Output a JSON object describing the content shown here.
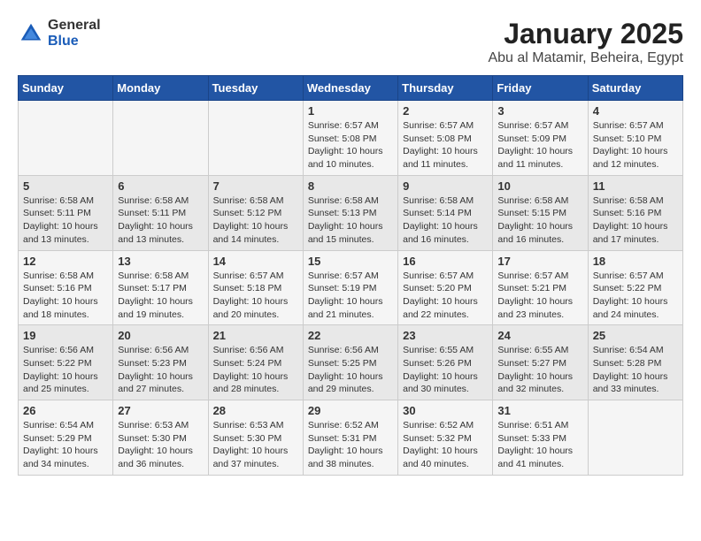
{
  "logo": {
    "general": "General",
    "blue": "Blue"
  },
  "title": "January 2025",
  "subtitle": "Abu al Matamir, Beheira, Egypt",
  "days_header": [
    "Sunday",
    "Monday",
    "Tuesday",
    "Wednesday",
    "Thursday",
    "Friday",
    "Saturday"
  ],
  "weeks": [
    [
      {
        "day": "",
        "info": ""
      },
      {
        "day": "",
        "info": ""
      },
      {
        "day": "",
        "info": ""
      },
      {
        "day": "1",
        "info": "Sunrise: 6:57 AM\nSunset: 5:08 PM\nDaylight: 10 hours\nand 10 minutes."
      },
      {
        "day": "2",
        "info": "Sunrise: 6:57 AM\nSunset: 5:08 PM\nDaylight: 10 hours\nand 11 minutes."
      },
      {
        "day": "3",
        "info": "Sunrise: 6:57 AM\nSunset: 5:09 PM\nDaylight: 10 hours\nand 11 minutes."
      },
      {
        "day": "4",
        "info": "Sunrise: 6:57 AM\nSunset: 5:10 PM\nDaylight: 10 hours\nand 12 minutes."
      }
    ],
    [
      {
        "day": "5",
        "info": "Sunrise: 6:58 AM\nSunset: 5:11 PM\nDaylight: 10 hours\nand 13 minutes."
      },
      {
        "day": "6",
        "info": "Sunrise: 6:58 AM\nSunset: 5:11 PM\nDaylight: 10 hours\nand 13 minutes."
      },
      {
        "day": "7",
        "info": "Sunrise: 6:58 AM\nSunset: 5:12 PM\nDaylight: 10 hours\nand 14 minutes."
      },
      {
        "day": "8",
        "info": "Sunrise: 6:58 AM\nSunset: 5:13 PM\nDaylight: 10 hours\nand 15 minutes."
      },
      {
        "day": "9",
        "info": "Sunrise: 6:58 AM\nSunset: 5:14 PM\nDaylight: 10 hours\nand 16 minutes."
      },
      {
        "day": "10",
        "info": "Sunrise: 6:58 AM\nSunset: 5:15 PM\nDaylight: 10 hours\nand 16 minutes."
      },
      {
        "day": "11",
        "info": "Sunrise: 6:58 AM\nSunset: 5:16 PM\nDaylight: 10 hours\nand 17 minutes."
      }
    ],
    [
      {
        "day": "12",
        "info": "Sunrise: 6:58 AM\nSunset: 5:16 PM\nDaylight: 10 hours\nand 18 minutes."
      },
      {
        "day": "13",
        "info": "Sunrise: 6:58 AM\nSunset: 5:17 PM\nDaylight: 10 hours\nand 19 minutes."
      },
      {
        "day": "14",
        "info": "Sunrise: 6:57 AM\nSunset: 5:18 PM\nDaylight: 10 hours\nand 20 minutes."
      },
      {
        "day": "15",
        "info": "Sunrise: 6:57 AM\nSunset: 5:19 PM\nDaylight: 10 hours\nand 21 minutes."
      },
      {
        "day": "16",
        "info": "Sunrise: 6:57 AM\nSunset: 5:20 PM\nDaylight: 10 hours\nand 22 minutes."
      },
      {
        "day": "17",
        "info": "Sunrise: 6:57 AM\nSunset: 5:21 PM\nDaylight: 10 hours\nand 23 minutes."
      },
      {
        "day": "18",
        "info": "Sunrise: 6:57 AM\nSunset: 5:22 PM\nDaylight: 10 hours\nand 24 minutes."
      }
    ],
    [
      {
        "day": "19",
        "info": "Sunrise: 6:56 AM\nSunset: 5:22 PM\nDaylight: 10 hours\nand 25 minutes."
      },
      {
        "day": "20",
        "info": "Sunrise: 6:56 AM\nSunset: 5:23 PM\nDaylight: 10 hours\nand 27 minutes."
      },
      {
        "day": "21",
        "info": "Sunrise: 6:56 AM\nSunset: 5:24 PM\nDaylight: 10 hours\nand 28 minutes."
      },
      {
        "day": "22",
        "info": "Sunrise: 6:56 AM\nSunset: 5:25 PM\nDaylight: 10 hours\nand 29 minutes."
      },
      {
        "day": "23",
        "info": "Sunrise: 6:55 AM\nSunset: 5:26 PM\nDaylight: 10 hours\nand 30 minutes."
      },
      {
        "day": "24",
        "info": "Sunrise: 6:55 AM\nSunset: 5:27 PM\nDaylight: 10 hours\nand 32 minutes."
      },
      {
        "day": "25",
        "info": "Sunrise: 6:54 AM\nSunset: 5:28 PM\nDaylight: 10 hours\nand 33 minutes."
      }
    ],
    [
      {
        "day": "26",
        "info": "Sunrise: 6:54 AM\nSunset: 5:29 PM\nDaylight: 10 hours\nand 34 minutes."
      },
      {
        "day": "27",
        "info": "Sunrise: 6:53 AM\nSunset: 5:30 PM\nDaylight: 10 hours\nand 36 minutes."
      },
      {
        "day": "28",
        "info": "Sunrise: 6:53 AM\nSunset: 5:30 PM\nDaylight: 10 hours\nand 37 minutes."
      },
      {
        "day": "29",
        "info": "Sunrise: 6:52 AM\nSunset: 5:31 PM\nDaylight: 10 hours\nand 38 minutes."
      },
      {
        "day": "30",
        "info": "Sunrise: 6:52 AM\nSunset: 5:32 PM\nDaylight: 10 hours\nand 40 minutes."
      },
      {
        "day": "31",
        "info": "Sunrise: 6:51 AM\nSunset: 5:33 PM\nDaylight: 10 hours\nand 41 minutes."
      },
      {
        "day": "",
        "info": ""
      }
    ]
  ]
}
